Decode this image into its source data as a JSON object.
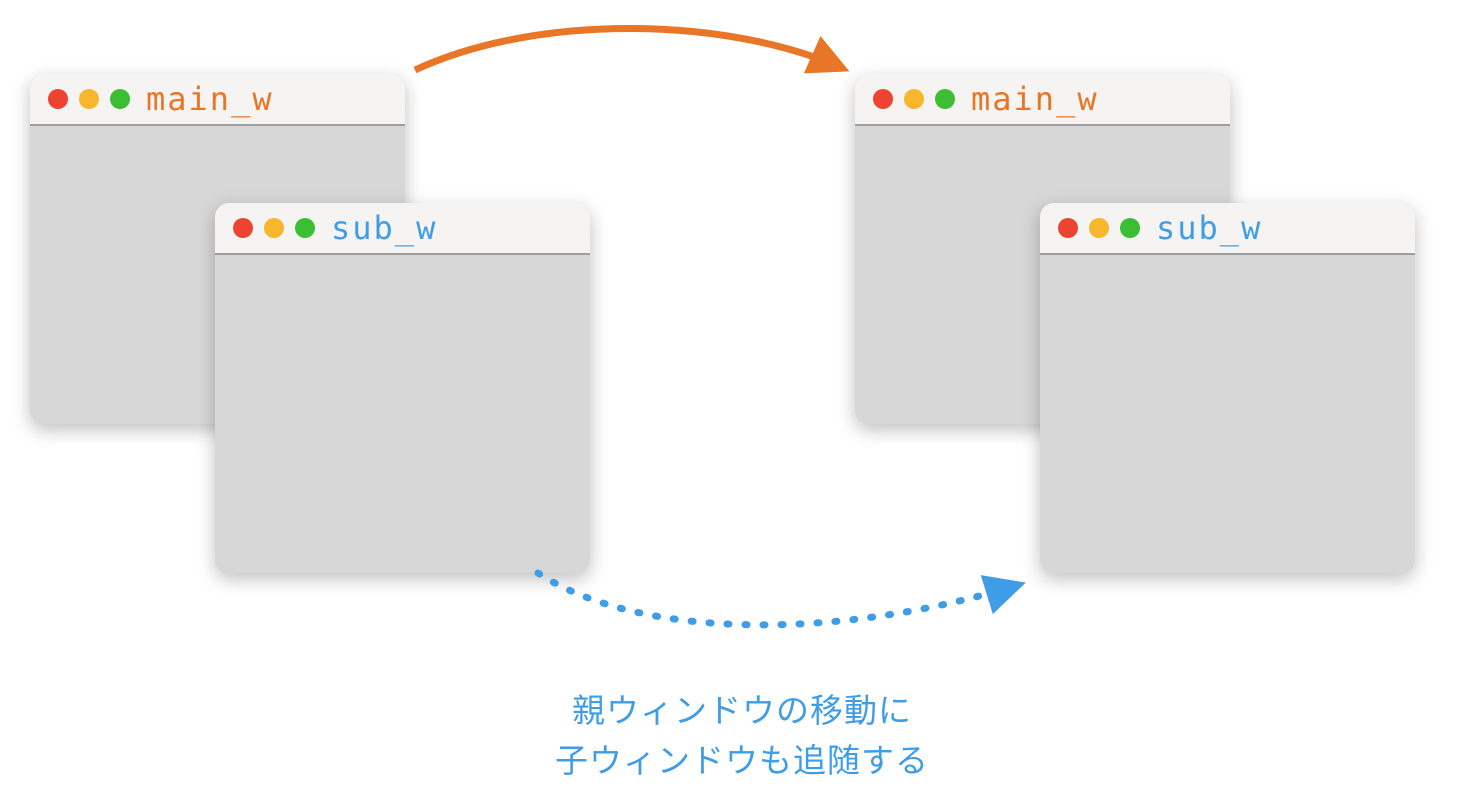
{
  "windows": {
    "left": {
      "main_title": "main_w",
      "sub_title": "sub_w"
    },
    "right": {
      "main_title": "main_w",
      "sub_title": "sub_w"
    }
  },
  "caption": {
    "line1": "親ウィンドウの移動に",
    "line2": "子ウィンドウも追随する"
  },
  "colors": {
    "main_title": "#e97626",
    "sub_title": "#3f9de8",
    "arrow_solid": "#e97626",
    "arrow_dotted": "#3f9de8"
  }
}
